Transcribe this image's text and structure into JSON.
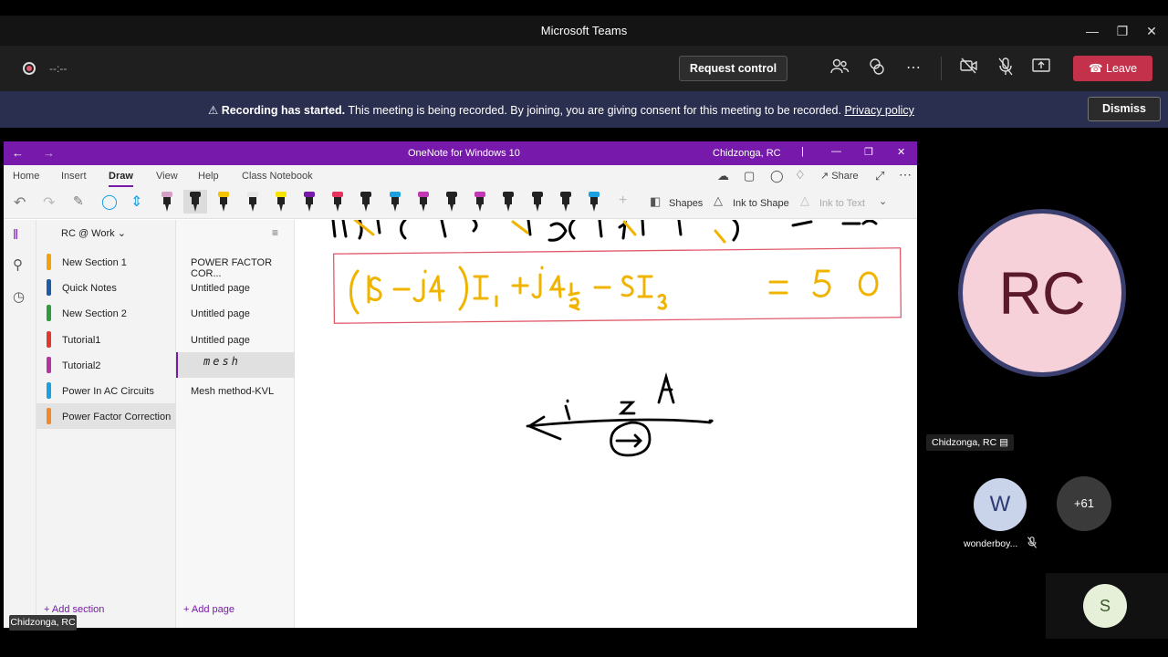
{
  "teams": {
    "window_title": "Microsoft Teams",
    "timer": "--:--",
    "request_control_label": "Request control",
    "leave_label": "Leave",
    "banner": {
      "bold": "Recording has started.",
      "text": "This meeting is being recorded. By joining, you are giving consent for this meeting to be recorded.",
      "link": "Privacy policy",
      "dismiss_label": "Dismiss"
    },
    "participants": {
      "main_initials": "RC",
      "main_name": "Chidzonga, RC",
      "second_initial": "W",
      "second_name": "wonderboy...",
      "overflow_count": "+61",
      "third_initial": "S"
    },
    "self_caption": "Chidzonga, RC"
  },
  "onenote": {
    "title": "OneNote for Windows 10",
    "user": "Chidzonga, RC",
    "tabs": [
      "Home",
      "Insert",
      "Draw",
      "View",
      "Help",
      "Class Notebook"
    ],
    "active_tab": "Draw",
    "share_label": "Share",
    "shapes_label": "Shapes",
    "ink_to_shape_label": "Ink to Shape",
    "ink_to_text_label": "Ink to Text",
    "notebook_name": "RC @ Work",
    "sections": [
      {
        "label": "New Section 1",
        "color": "#f0a30a"
      },
      {
        "label": "Quick Notes",
        "color": "#1f5aa6"
      },
      {
        "label": "New Section 2",
        "color": "#2e9b3e"
      },
      {
        "label": "Tutorial1",
        "color": "#e1392b"
      },
      {
        "label": "Tutorial2",
        "color": "#b4359b"
      },
      {
        "label": "Power In AC Circuits",
        "color": "#1ba1e2"
      },
      {
        "label": "Power Factor Correction",
        "color": "#f08a24"
      }
    ],
    "active_section": "Power Factor Correction",
    "pages": [
      "POWER FACTOR COR...",
      "Untitled page",
      "Untitled page",
      "Untitled page",
      "mesh",
      "Mesh method-KVL"
    ],
    "active_page": "mesh",
    "add_section_label": "Add section",
    "add_page_label": "Add page",
    "pens": [
      "#d4a0c8",
      "#222222",
      "#f5c400",
      "#e8e8e8",
      "#f5e400",
      "#7719aa",
      "#e8335f",
      "#222222",
      "#1ba1e2",
      "#c238b5",
      "#222222",
      "#c238b5",
      "#222222",
      "#222222",
      "#222222",
      "#1ba1e2"
    ]
  },
  "colors": {
    "onenote_purple": "#7719aa",
    "leave_red": "#c4314b",
    "banner_bg": "#2b2f4f"
  }
}
